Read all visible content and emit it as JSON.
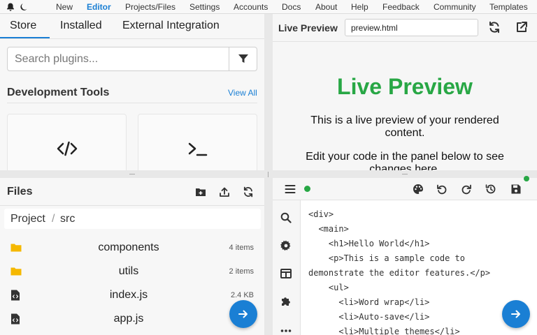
{
  "nav": {
    "items": [
      "New",
      "Editor",
      "Projects/Files",
      "Settings",
      "Accounts",
      "Docs",
      "About",
      "Help",
      "Feedback",
      "Community",
      "Templates"
    ],
    "active": "Editor"
  },
  "plugins": {
    "tabs": [
      "Store",
      "Installed",
      "External Integration"
    ],
    "active_tab": "Store",
    "search_placeholder": "Search plugins...",
    "section_title": "Development Tools",
    "view_all": "View All",
    "cards": [
      {
        "icon": "code-icon"
      },
      {
        "icon": "terminal-icon"
      }
    ]
  },
  "preview": {
    "title": "Live Preview",
    "file": "preview.html",
    "heading": "Live Preview",
    "paragraph1": "This is a live preview of your rendered content.",
    "paragraph2": "Edit your code in the panel below to see changes here."
  },
  "files": {
    "title": "Files",
    "breadcrumb": [
      "Project",
      "src"
    ],
    "breadcrumb_separator": "/",
    "items": [
      {
        "name": "components",
        "meta": "4 items",
        "icon": "folder-icon"
      },
      {
        "name": "utils",
        "meta": "2 items",
        "icon": "folder-icon"
      },
      {
        "name": "index.js",
        "meta": "2.4 KB",
        "icon": "code-file-icon"
      },
      {
        "name": "app.js",
        "meta": "",
        "icon": "code-file-icon"
      }
    ]
  },
  "editor": {
    "code_lines": [
      "<div>",
      "  <main>",
      "    <h1>Hello World</h1>",
      "    <p>This is a sample code to",
      "demonstrate the editor features.</p>",
      "    <ul>",
      "      <li>Word wrap</li>",
      "      <li>Auto-save</li>",
      "      <li>Multiple themes</li>"
    ]
  },
  "colors": {
    "accent": "#1a7fd4",
    "success": "#28a745",
    "folder": "#f5b800"
  }
}
